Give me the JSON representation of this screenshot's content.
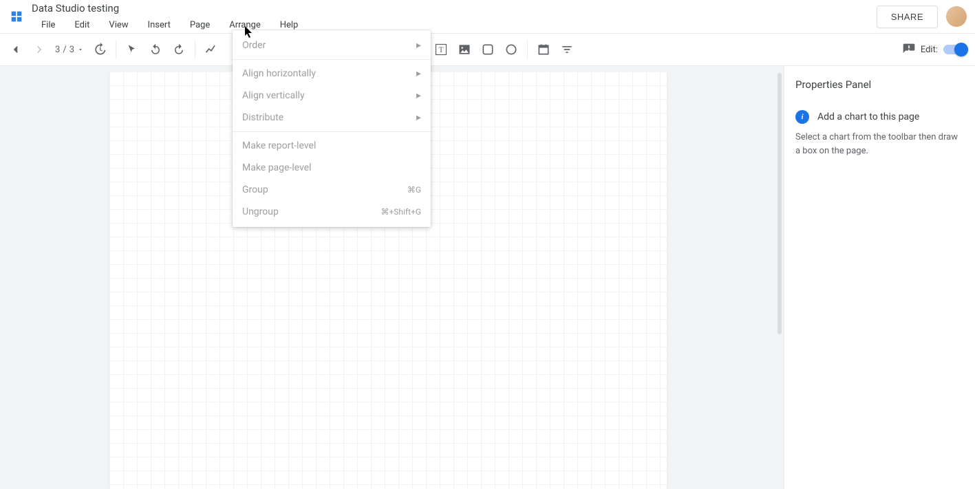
{
  "header": {
    "doc_title": "Data Studio testing",
    "share_label": "SHARE"
  },
  "menubar": {
    "items": [
      "File",
      "Edit",
      "View",
      "Insert",
      "Page",
      "Arrange",
      "Help"
    ]
  },
  "toolbar": {
    "page_current": "3",
    "page_total": "3",
    "edit_label": "Edit:"
  },
  "dropdown": {
    "items": [
      {
        "label": "Order",
        "submenu": true
      },
      {
        "sep": true
      },
      {
        "label": "Align horizontally",
        "submenu": true
      },
      {
        "label": "Align vertically",
        "submenu": true
      },
      {
        "label": "Distribute",
        "submenu": true
      },
      {
        "sep": true
      },
      {
        "label": "Make report-level"
      },
      {
        "label": "Make page-level"
      },
      {
        "label": "Group",
        "kbd": "⌘G"
      },
      {
        "label": "Ungroup",
        "kbd": "⌘+Shift+G"
      }
    ]
  },
  "panel": {
    "title": "Properties Panel",
    "hint_title": "Add a chart to this page",
    "hint_body": "Select a chart from the toolbar then draw a box on the page."
  }
}
